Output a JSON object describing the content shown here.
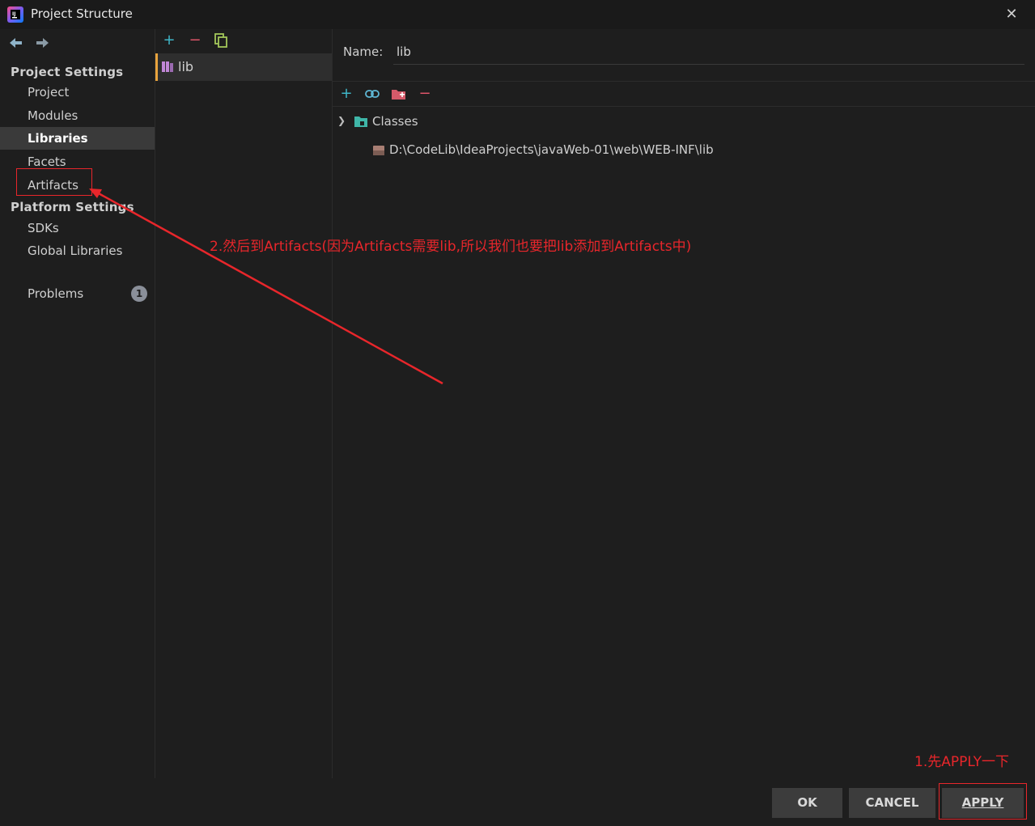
{
  "window": {
    "title": "Project Structure"
  },
  "sidebar": {
    "project_settings_header": "Project Settings",
    "project_items": [
      {
        "label": "Project",
        "selected": false
      },
      {
        "label": "Modules",
        "selected": false
      },
      {
        "label": "Libraries",
        "selected": true
      },
      {
        "label": "Facets",
        "selected": false
      },
      {
        "label": "Artifacts",
        "selected": false
      }
    ],
    "platform_settings_header": "Platform Settings",
    "platform_items": [
      {
        "label": "SDKs"
      },
      {
        "label": "Global Libraries"
      }
    ],
    "problems_label": "Problems",
    "problems_count": "1"
  },
  "libraries": {
    "items": [
      {
        "label": "lib"
      }
    ]
  },
  "detail": {
    "name_label": "Name:",
    "name_value": "lib",
    "classes_label": "Classes",
    "class_path": "D:\\CodeLib\\IdeaProjects\\javaWeb-01\\web\\WEB-INF\\lib"
  },
  "annotations": {
    "step2": "2.然后到Artifacts(因为Artifacts需要lib,所以我们也要把lib添加到Artifacts中)",
    "step1": "1.先APPLY一下"
  },
  "footer": {
    "ok_label": "OK",
    "cancel_label": "CANCEL",
    "apply_label": "APPLY"
  },
  "colors": {
    "accent_red": "#e8262b",
    "selection_bar": "#e8a33d",
    "add_icon": "#3fb6c8",
    "remove_icon": "#e0556a"
  }
}
